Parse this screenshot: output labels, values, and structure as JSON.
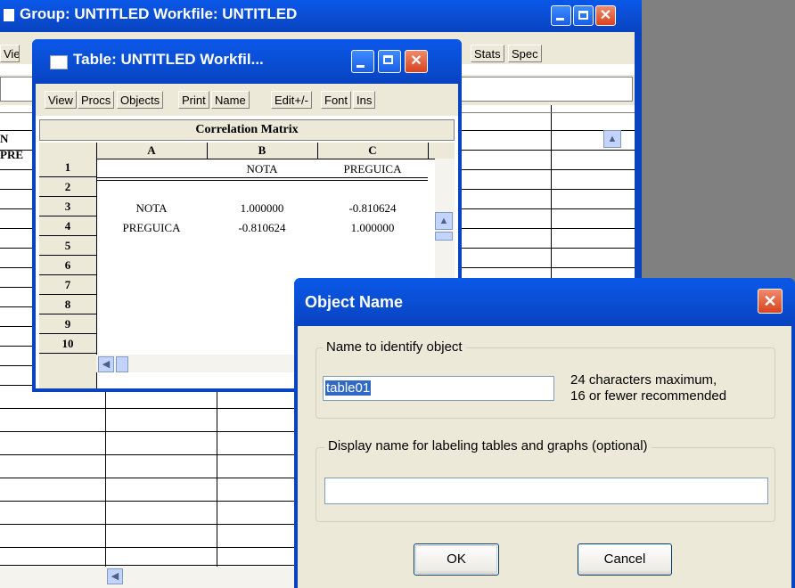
{
  "group_window": {
    "title": "Group: UNTITLED   Workfile: UNTITLED",
    "toolbar_left": "View",
    "toolbar_right": [
      "Stats",
      "Spec"
    ],
    "left_labels": [
      "N",
      "PRE"
    ]
  },
  "table_window": {
    "title": "Table: UNTITLED   Workfil...",
    "toolbar": [
      "View",
      "Procs",
      "Objects",
      "Print",
      "Name",
      "Edit+/-",
      "Font",
      "Ins"
    ],
    "header_label": "Correlation Matrix",
    "columns": [
      "A",
      "B",
      "C"
    ],
    "row_numbers": [
      "1",
      "2",
      "3",
      "4",
      "5",
      "6",
      "7",
      "8",
      "9",
      "10"
    ],
    "rows": [
      {
        "a": "",
        "b": "NOTA",
        "c": "PREGUICA"
      },
      {
        "a": "",
        "b": "",
        "c": ""
      },
      {
        "a": "NOTA",
        "b": "1.000000",
        "c": "-0.810624"
      },
      {
        "a": "PREGUICA",
        "b": "-0.810624",
        "c": "1.000000"
      }
    ]
  },
  "dialog": {
    "title": "Object Name",
    "group1_label": "Name to identify object",
    "name_value": "table01",
    "hint_line1": "24 characters maximum,",
    "hint_line2": "16 or fewer recommended",
    "group2_label": "Display name for labeling tables and graphs  (optional)",
    "display_value": "",
    "ok_label": "OK",
    "cancel_label": "Cancel"
  },
  "colors": {
    "xp_title": "#0a4fd6",
    "window_face": "#ece9d8",
    "desktop": "#808080",
    "selection": "#316ac5"
  }
}
